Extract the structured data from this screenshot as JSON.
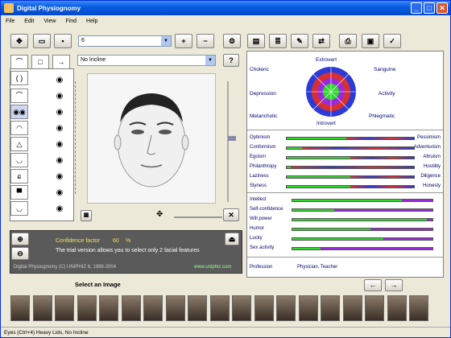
{
  "window": {
    "title": "Digital Physiognomy",
    "icons": [
      "minimize-icon",
      "maximize-icon",
      "close-icon"
    ]
  },
  "menu": [
    "File",
    "Edit",
    "View",
    "Find",
    "Help"
  ],
  "toolbar": {
    "number_value": "6",
    "incline_value": "No Incline",
    "help_label": "?"
  },
  "radar": {
    "top": "Extrovert",
    "bottom": "Introvert",
    "left_top": "Choleric",
    "right_top": "Sanguine",
    "left_mid": "Depression",
    "right_mid": "Activity",
    "left_bottom": "Melancholic",
    "right_bottom": "Phlegmatic"
  },
  "pairs": [
    {
      "left": "Optimism",
      "right": "Pessimism",
      "value": 0.47
    },
    {
      "left": "Conformism",
      "right": "Adventurism",
      "value": 0.12
    },
    {
      "left": "Egoism",
      "right": "Altruism",
      "value": 0.5
    },
    {
      "left": "Philanthropy",
      "right": "Hostility",
      "value": 0.03
    },
    {
      "left": "Laziness",
      "right": "Diligence",
      "value": 0.5
    },
    {
      "left": "Slyness",
      "right": "Honesty",
      "value": 0.5
    }
  ],
  "singles": [
    {
      "label": "Intellect",
      "value": 0.78
    },
    {
      "label": "Self-confidence",
      "value": 0.3
    },
    {
      "label": "Will power",
      "value": 0.96
    },
    {
      "label": "Humor",
      "value": 0.56
    },
    {
      "label": "Lucky",
      "value": 0.65
    },
    {
      "label": "Sex activity",
      "value": 0.2
    }
  ],
  "profession": {
    "label": "Profession",
    "value": "Physician, Teacher"
  },
  "info": {
    "confidence_label": "Confidence factor",
    "confidence_value": "60",
    "confidence_unit": "%",
    "trial_text": "The trial version allows you to select only 2 facial features",
    "copyright": "Digital Physiognomy (C) UNIPHIZ 6, 1999-2004",
    "site": "www.uniphiz.com"
  },
  "gallery": {
    "title": "Select an Image"
  },
  "status": "Eyes (Ctrl+4) Heavy Lids, No Incline",
  "colors": {
    "green": "#2ed62e",
    "blue": "#2c3ad8",
    "red": "#d83030",
    "purple": "#9a2ad8",
    "label_blue": "#00007a"
  }
}
